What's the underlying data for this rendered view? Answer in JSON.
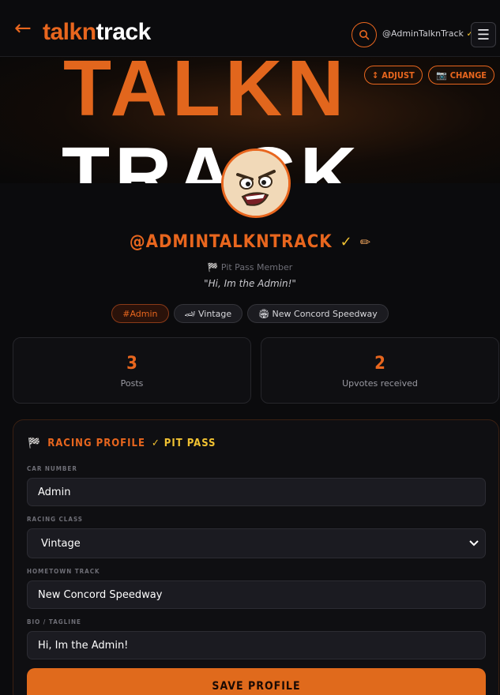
{
  "header": {
    "back_label": "←",
    "brand_part1": "talkn",
    "brand_part2": "track",
    "username": "@AdminTalknTrack",
    "verified_mark": "✓",
    "menu_label": "☰"
  },
  "banner": {
    "line1": "TALKN",
    "line2": "TRACK",
    "adjust_label": "ADJUST",
    "adjust_glyph": "↕",
    "change_label": "CHANGE",
    "change_glyph": "📷"
  },
  "profile": {
    "handle": "@ADMINTALKNTRACK",
    "verified_mark": "✓",
    "edit_glyph": "✏",
    "member_glyph": "🏁",
    "member_text": "Pit Pass Member",
    "tagline": "\"Hi, Im the Admin!\"",
    "tags": [
      "#Admin",
      "🏎 Vintage",
      "🏟 New Concord Speedway"
    ]
  },
  "stats": [
    {
      "value": "3",
      "label": "Posts"
    },
    {
      "value": "2",
      "label": "Upvotes received"
    }
  ],
  "racing_profile": {
    "title_glyph": "🏁",
    "title": "RACING PROFILE",
    "badge": "✓ PIT PASS",
    "car_number_label": "CAR NUMBER",
    "car_number_value": "Admin",
    "racing_class_label": "RACING CLASS",
    "racing_class_value": "Vintage",
    "hometown_label": "HOMETOWN TRACK",
    "hometown_value": "New Concord Speedway",
    "bio_label": "BIO / TAGLINE",
    "bio_value": "Hi, Im the Admin!",
    "save_label": "SAVE PROFILE"
  },
  "colors": {
    "accent": "#e8661e",
    "gold": "#f1c232",
    "background": "#0b0b0d",
    "card": "#0f0f12"
  }
}
